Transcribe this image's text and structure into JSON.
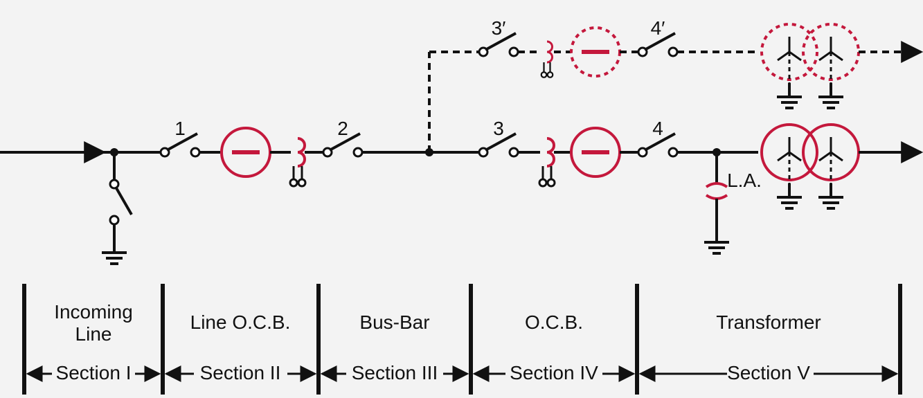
{
  "switches": {
    "s1": "1",
    "s2": "2",
    "s3": "3",
    "s4": "4",
    "s3p": "3′",
    "s4p": "4′"
  },
  "la_label": "L.A.",
  "sections": {
    "s1": {
      "title1": "Incoming",
      "title2": "Line",
      "label": "Section I"
    },
    "s2": {
      "title1": "Line O.C.B.",
      "label": "Section II"
    },
    "s3": {
      "title1": "Bus-Bar",
      "label": "Section III"
    },
    "s4": {
      "title1": "O.C.B.",
      "label": "Section IV"
    },
    "s5": {
      "title1": "Transformer",
      "label": "Section V"
    }
  }
}
